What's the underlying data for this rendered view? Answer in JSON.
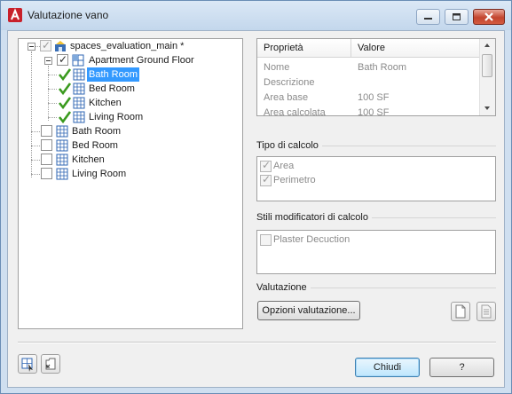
{
  "window": {
    "title": "Valutazione vano"
  },
  "tree": {
    "root": {
      "label": "spaces_evaluation_main *"
    },
    "group": {
      "label": "Apartment Ground Floor"
    },
    "children": [
      {
        "label": "Bath Room",
        "selected": true
      },
      {
        "label": "Bed Room"
      },
      {
        "label": "Kitchen"
      },
      {
        "label": "Living Room"
      }
    ],
    "spaces": [
      {
        "label": "Bath Room"
      },
      {
        "label": "Bed Room"
      },
      {
        "label": "Kitchen"
      },
      {
        "label": "Living Room"
      }
    ]
  },
  "properties": {
    "headers": {
      "name": "Proprietà",
      "value": "Valore"
    },
    "rows": [
      {
        "name": "Nome",
        "value": "Bath Room"
      },
      {
        "name": "Descrizione",
        "value": ""
      },
      {
        "name": "Area base",
        "value": "100  SF"
      },
      {
        "name": "Area calcolata",
        "value": "100  SF"
      }
    ]
  },
  "calc_type": {
    "caption": "Tipo di calcolo",
    "options": [
      {
        "label": "Area",
        "checked": true
      },
      {
        "label": "Perimetro",
        "checked": true
      }
    ]
  },
  "modifier_styles": {
    "caption": "Stili modificatori di calcolo",
    "options": [
      {
        "label": "Plaster Decuction",
        "checked": false
      }
    ]
  },
  "evaluation": {
    "caption": "Valutazione",
    "options_button": "Opzioni valutazione..."
  },
  "footer": {
    "close_button": "Chiudi",
    "help_button": "?"
  },
  "colors": {
    "selection": "#3399ff",
    "check_green": "#3a9a1e",
    "title_bar": "#c9dcef",
    "close_red": "#c3452f"
  }
}
